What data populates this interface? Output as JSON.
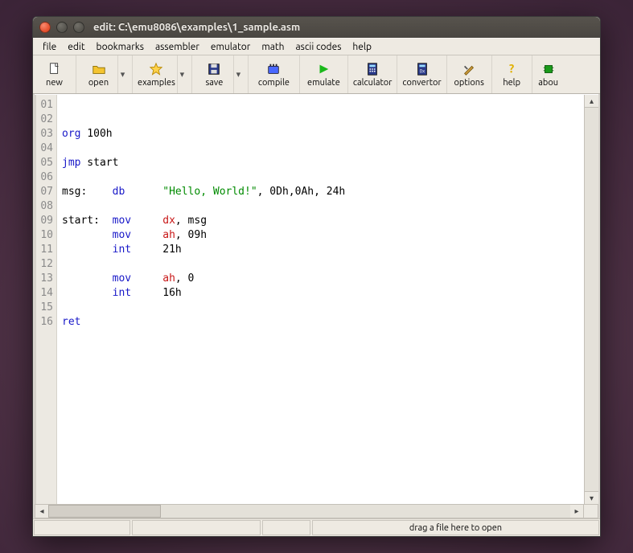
{
  "title": "edit: C:\\emu8086\\examples\\1_sample.asm",
  "menu": {
    "file": "file",
    "edit": "edit",
    "bookmarks": "bookmarks",
    "assembler": "assembler",
    "emulator": "emulator",
    "math": "math",
    "ascii": "ascii codes",
    "help": "help"
  },
  "toolbar": {
    "new": "new",
    "open": "open",
    "examples": "examples",
    "save": "save",
    "compile": "compile",
    "emulate": "emulate",
    "calculator": "calculator",
    "convertor": "convertor",
    "options": "options",
    "help": "help",
    "about": "abou"
  },
  "gutter": [
    "01",
    "02",
    "03",
    "04",
    "05",
    "06",
    "07",
    "08",
    "09",
    "10",
    "11",
    "12",
    "13",
    "14",
    "15",
    "16"
  ],
  "code": [
    [],
    [],
    [
      {
        "t": "org",
        "c": "kw-blue"
      },
      {
        "t": " 100h"
      }
    ],
    [],
    [
      {
        "t": "jmp",
        "c": "kw-blue"
      },
      {
        "t": " start"
      }
    ],
    [],
    [
      {
        "t": "msg:    "
      },
      {
        "t": "db",
        "c": "kw-blue"
      },
      {
        "t": "      "
      },
      {
        "t": "\"Hello, World!\"",
        "c": "str"
      },
      {
        "t": ", 0Dh,0Ah, 24h"
      }
    ],
    [],
    [
      {
        "t": "start:  "
      },
      {
        "t": "mov",
        "c": "kw-blue"
      },
      {
        "t": "     "
      },
      {
        "t": "dx",
        "c": "kw-red"
      },
      {
        "t": ", msg"
      }
    ],
    [
      {
        "t": "        "
      },
      {
        "t": "mov",
        "c": "kw-blue"
      },
      {
        "t": "     "
      },
      {
        "t": "ah",
        "c": "kw-red"
      },
      {
        "t": ", 09h"
      }
    ],
    [
      {
        "t": "        "
      },
      {
        "t": "int",
        "c": "kw-blue"
      },
      {
        "t": "     21h"
      }
    ],
    [],
    [
      {
        "t": "        "
      },
      {
        "t": "mov",
        "c": "kw-blue"
      },
      {
        "t": "     "
      },
      {
        "t": "ah",
        "c": "kw-red"
      },
      {
        "t": ", 0"
      }
    ],
    [
      {
        "t": "        "
      },
      {
        "t": "int",
        "c": "kw-blue"
      },
      {
        "t": "     16h"
      }
    ],
    [],
    [
      {
        "t": "ret",
        "c": "kw-blue"
      }
    ]
  ],
  "status": {
    "drag": "drag a file here to open"
  },
  "scroll": {
    "up": "▴",
    "down": "▾",
    "left": "◂",
    "right": "▸"
  }
}
